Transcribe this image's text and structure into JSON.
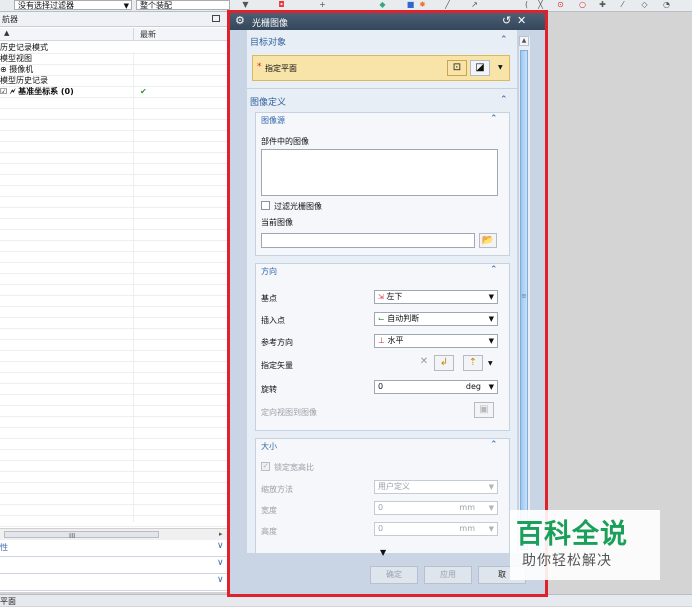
{
  "toolbar": {
    "filter_select": "没有选择过滤器",
    "scope_select": "整个装配"
  },
  "navigator": {
    "title": "航器",
    "col_latest": "最新",
    "rows": [
      {
        "label": "历史记录模式",
        "check": ""
      },
      {
        "label": "模型视图",
        "check": ""
      },
      {
        "label": "⊕ 摄像机",
        "check": ""
      },
      {
        "label": "模型历史记录",
        "check": ""
      },
      {
        "label": "☑ 🗲 基准坐标系 (0)",
        "check": "✔"
      }
    ],
    "hscroll_label": "III",
    "panels": [
      "性",
      "",
      ""
    ]
  },
  "status": {
    "text": "平面"
  },
  "dialog": {
    "title": "光栅图像",
    "target_section": "目标对象",
    "specify_plane": "指定平面",
    "image_def_section": "图像定义",
    "image_source_sub": "图像源",
    "part_images_label": "部件中的图像",
    "filter_raster_label": "过滤光栅图像",
    "current_image_label": "当前图像",
    "current_image_value": "",
    "orientation_sub": "方向",
    "base_point_label": "基点",
    "base_point_value": "左下",
    "insert_point_label": "插入点",
    "insert_point_value": "自动判断",
    "ref_dir_label": "参考方向",
    "ref_dir_value": "水平",
    "specify_vector_label": "指定矢量",
    "rotation_label": "旋转",
    "rotation_value": "0",
    "rotation_unit": "deg",
    "orient_view_label": "定向视图到图像",
    "size_sub": "大小",
    "lock_aspect_label": "锁定宽高比",
    "scale_method_label": "缩放方法",
    "scale_method_value": "用户定义",
    "width_label": "宽度",
    "width_value": "0",
    "width_unit": "mm",
    "height_label": "高度",
    "height_value": "0",
    "height_unit": "mm",
    "ok_label": "确定",
    "apply_label": "应用",
    "cancel_label": "取"
  },
  "watermark": {
    "title": "百科全说",
    "subtitle": "助你轻松解决",
    "color": "#1aa05a"
  },
  "colors": {
    "highlight_frame": "#e0202a",
    "required_field": "#f8e3a8",
    "required_star": "#e02020",
    "section_header": "#2f5f9e"
  }
}
